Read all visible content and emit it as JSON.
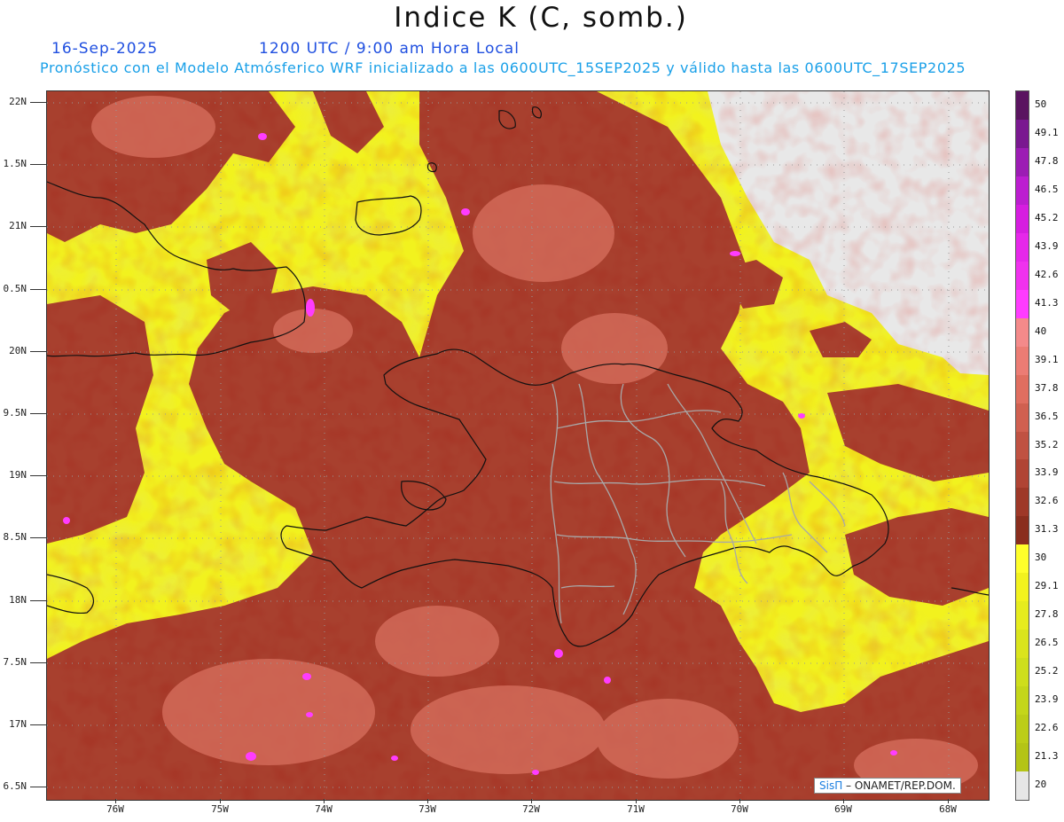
{
  "header": {
    "title": "Indice K (C, somb.)",
    "date": "16-Sep-2025",
    "time": "1200 UTC / 9:00 am Hora Local",
    "forecast": "Pronóstico con el Modelo Atmósferico WRF inicializado a las 0600UTC_15SEP2025 y válido hasta las  0600UTC_17SEP2025"
  },
  "map": {
    "lat_labels": [
      "22N",
      "1.5N",
      "21N",
      "0.5N",
      "20N",
      "9.5N",
      "19N",
      "8.5N",
      "18N",
      "7.5N",
      "17N",
      "6.5N"
    ],
    "lon_labels": [
      "76W",
      "75W",
      "74W",
      "73W",
      "72W",
      "71W",
      "70W",
      "69W",
      "68W"
    ],
    "lat_range": [
      16.4,
      22.1
    ],
    "lon_range": [
      -76.65,
      -67.6
    ]
  },
  "colorbar": {
    "levels": [
      "50",
      "49.1",
      "47.8",
      "46.5",
      "45.2",
      "43.9",
      "42.6",
      "41.3",
      "40",
      "39.1",
      "37.8",
      "36.5",
      "35.2",
      "33.9",
      "32.6",
      "31.3",
      "30",
      "29.1",
      "27.8",
      "26.5",
      "25.2",
      "23.9",
      "22.6",
      "21.3",
      "20"
    ],
    "colors": [
      "#5a1460",
      "#7a1890",
      "#9c1cb4",
      "#bc1ed0",
      "#d61ee0",
      "#e628ea",
      "#f032ee",
      "#ff3cff",
      "#f48a8a",
      "#ec7c74",
      "#e06e60",
      "#d06050",
      "#c05242",
      "#b04434",
      "#9e3828",
      "#8a2e1e",
      "#ffff2a",
      "#f2f21e",
      "#e6ec1e",
      "#dae41c",
      "#cede1c",
      "#c4d61a",
      "#bccd18",
      "#b4c416",
      "#e6e6e6"
    ]
  },
  "credit": {
    "brand": "SisΠ",
    "org": " – ONAMET/REP.DOM."
  }
}
